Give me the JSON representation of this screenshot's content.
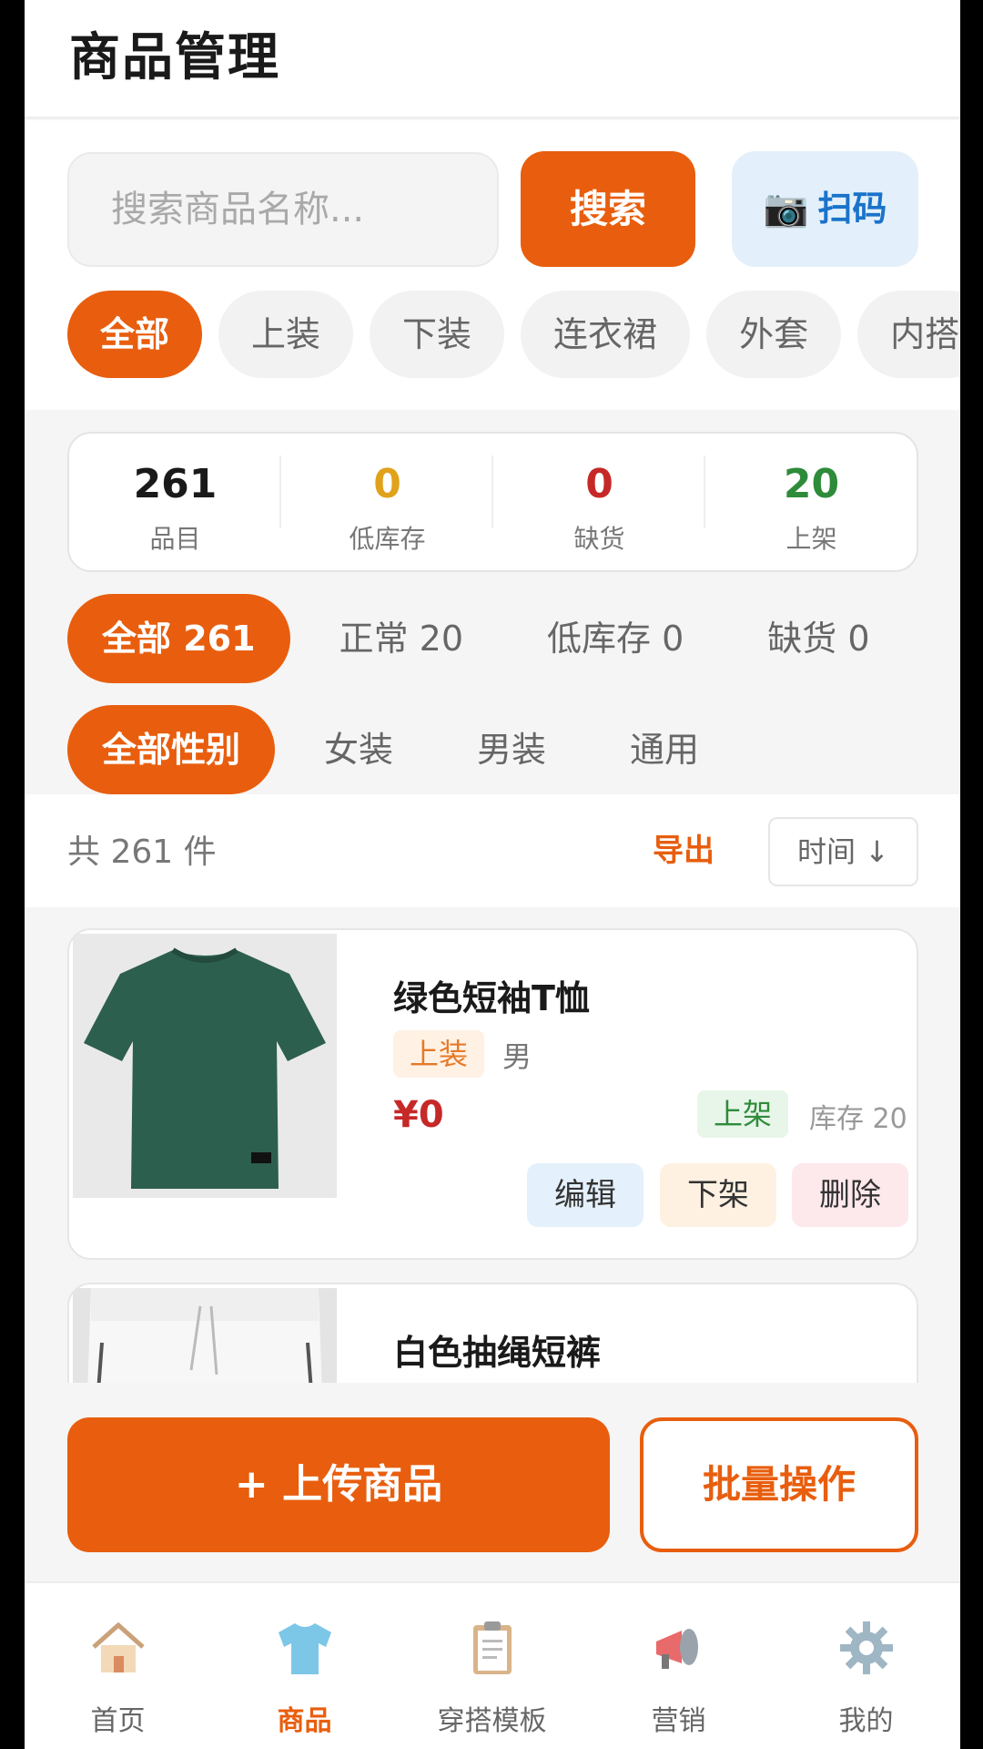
{
  "header": {
    "title": "商品管理"
  },
  "search": {
    "placeholder": "搜索商品名称...",
    "button": "搜索",
    "scan_icon": "camera-icon",
    "scan_label": "扫码"
  },
  "categories": [
    "全部",
    "上装",
    "下装",
    "连衣裙",
    "外套",
    "内搭"
  ],
  "stats": [
    {
      "value": "261",
      "label": "品目",
      "color": "#1a1a1a"
    },
    {
      "value": "0",
      "label": "低库存",
      "color": "#e0a21a"
    },
    {
      "value": "0",
      "label": "缺货",
      "color": "#c62828"
    },
    {
      "value": "20",
      "label": "上架",
      "color": "#2e8b3a"
    }
  ],
  "status_filters": [
    "全部 261",
    "正常 20",
    "低库存 0",
    "缺货 0"
  ],
  "gender_filters": [
    "全部性别",
    "女装",
    "男装",
    "通用"
  ],
  "list": {
    "total": "共 261 件",
    "export": "导出",
    "sort": "时间 ↓"
  },
  "products": [
    {
      "name": "绿色短袖T恤",
      "category": "上装",
      "gender": "男",
      "price": "¥0",
      "status": "上架",
      "stock": "库存 20",
      "actions": {
        "edit": "编辑",
        "offline": "下架",
        "delete": "删除"
      }
    },
    {
      "name": "白色抽绳短裤"
    }
  ],
  "bottom": {
    "upload": "+ 上传商品",
    "batch": "批量操作"
  },
  "tabs": [
    {
      "label": "首页",
      "icon": "home-icon"
    },
    {
      "label": "商品",
      "icon": "tshirt-icon"
    },
    {
      "label": "穿搭模板",
      "icon": "clipboard-icon"
    },
    {
      "label": "营销",
      "icon": "megaphone-icon"
    },
    {
      "label": "我的",
      "icon": "gear-icon"
    }
  ],
  "colors": {
    "accent": "#e85e0e"
  }
}
